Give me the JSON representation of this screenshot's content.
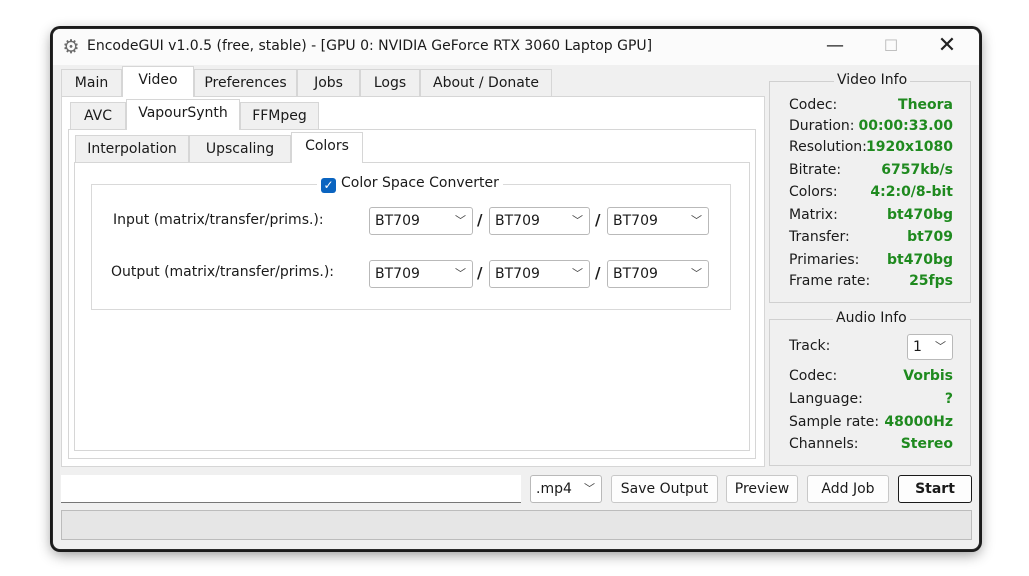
{
  "window": {
    "title": "EncodeGUI v1.0.5 (free, stable) - [GPU 0: NVIDIA GeForce RTX 3060 Laptop GPU]",
    "min_glyph": "—",
    "max_glyph": "☐",
    "close_glyph": "✕"
  },
  "main_tabs": [
    "Main",
    "Video",
    "Preferences",
    "Jobs",
    "Logs",
    "About / Donate"
  ],
  "video_tabs": [
    "AVC",
    "VapourSynth",
    "FFMpeg"
  ],
  "vs_tabs": [
    "Interpolation",
    "Upscaling",
    "Colors"
  ],
  "colors": {
    "group_label": "Color Space Converter",
    "checked": true,
    "input_label": "Input (matrix/transfer/prims.):",
    "output_label": "Output (matrix/transfer/prims.):",
    "input_values": [
      "BT709",
      "BT709",
      "BT709"
    ],
    "output_values": [
      "BT709",
      "BT709",
      "BT709"
    ],
    "separator": "/"
  },
  "video_info": {
    "title": "Video Info",
    "codec_label": "Codec:",
    "codec": "Theora",
    "duration_label": "Duration:",
    "duration": "00:00:33.00",
    "resolution_label": "Resolution:",
    "resolution": "1920x1080",
    "bitrate_label": "Bitrate:",
    "bitrate": "6757kb/s",
    "colors_label": "Colors:",
    "colors": "4:2:0/8-bit",
    "matrix_label": "Matrix:",
    "matrix": "bt470bg",
    "transfer_label": "Transfer:",
    "transfer": "bt709",
    "primaries_label": "Primaries:",
    "primaries": "bt470bg",
    "framerate_label": "Frame rate:",
    "framerate": "25fps"
  },
  "audio_info": {
    "title": "Audio Info",
    "track_label": "Track:",
    "track": "1",
    "codec_label": "Codec:",
    "codec": "Vorbis",
    "language_label": "Language:",
    "language": "?",
    "samplerate_label": "Sample rate:",
    "samplerate": "48000Hz",
    "channels_label": "Channels:",
    "channels": "Stereo"
  },
  "bottom": {
    "output_path": "",
    "container": ".mp4",
    "save_output": "Save Output",
    "preview": "Preview",
    "add_job": "Add Job",
    "start": "Start"
  },
  "accent_color": "#1f8a1f",
  "checkbox_color": "#0a64c0"
}
